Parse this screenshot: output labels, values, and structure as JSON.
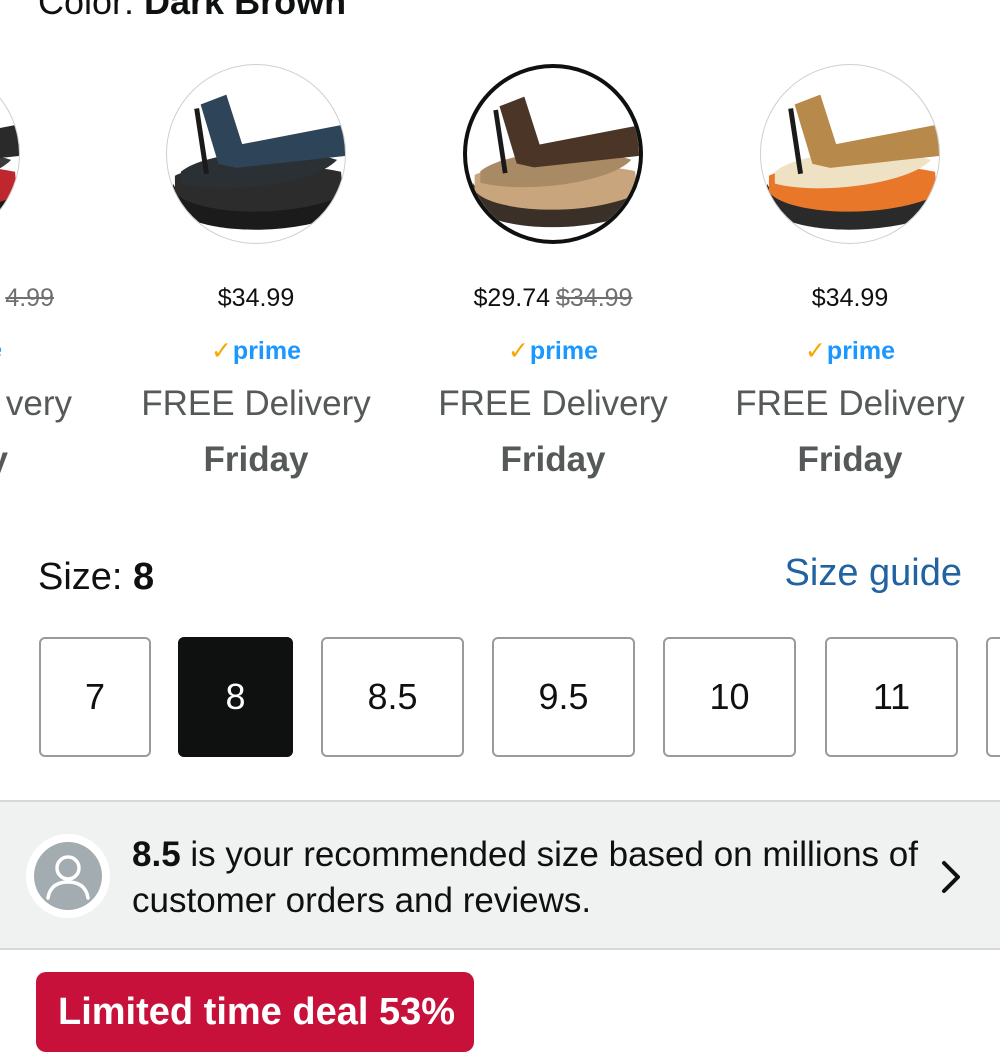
{
  "color": {
    "label": "Color: ",
    "value": "Dark Brown"
  },
  "swatches": [
    {
      "price": "",
      "was": "4.99",
      "prime": "e",
      "delivery": "very",
      "day": "y",
      "colors": {
        "upper": "#2a2a2a",
        "sole": "#1a1a1a",
        "accent": "#c0262d",
        "bed": "#3a3a3a"
      }
    },
    {
      "price": "$34.99",
      "was": "",
      "prime": "prime",
      "delivery": "FREE Delivery",
      "day": "Friday",
      "colors": {
        "upper": "#2e4458",
        "sole": "#1b1b1b",
        "accent": "#2c2c2c",
        "bed": "#2b3035"
      }
    },
    {
      "price": "$29.74",
      "was": "$34.99",
      "prime": "prime",
      "delivery": "FREE Delivery",
      "day": "Friday",
      "colors": {
        "upper": "#4a3527",
        "sole": "#3b3028",
        "accent": "#c8a57c",
        "bed": "#a88a64"
      }
    },
    {
      "price": "$34.99",
      "was": "",
      "prime": "prime",
      "delivery": "FREE Delivery",
      "day": "Friday",
      "colors": {
        "upper": "#b78a4c",
        "sole": "#2a2a2a",
        "accent": "#e8772a",
        "bed": "#efe2c4"
      }
    }
  ],
  "size": {
    "label": "Size: ",
    "value": "8",
    "guide_label": "Size guide",
    "options": [
      "7",
      "8",
      "8.5",
      "9.5",
      "10",
      "11"
    ],
    "selected": "8"
  },
  "recommendation": {
    "size": "8.5",
    "text": " is your recommended size based on millions of customer orders and reviews."
  },
  "cta": {
    "label": "Limited time deal 53%"
  },
  "palette": {
    "link": "#2162a1",
    "prime_blue": "#1a98ff",
    "prime_check": "#f7a700",
    "deal_red": "#c7113a"
  }
}
